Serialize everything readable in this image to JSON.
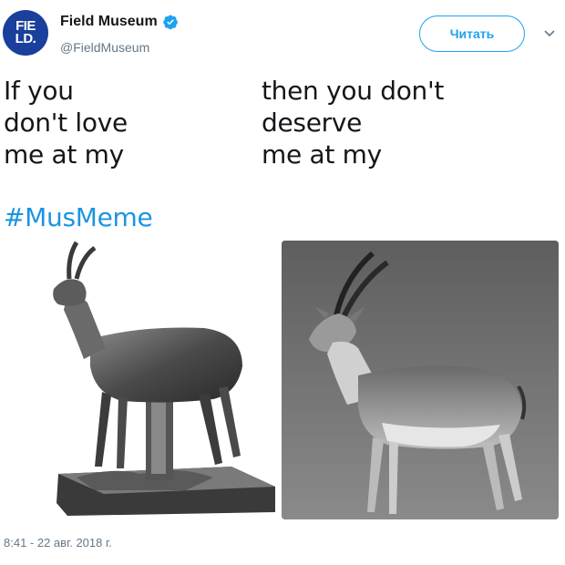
{
  "account": {
    "avatar_text_line1": "FIE",
    "avatar_text_line2": "LD.",
    "name": "Field Museum",
    "handle": "@FieldMuseum",
    "verified": true
  },
  "actions": {
    "follow_label": "Читать",
    "menu_icon": "chevron-down-icon"
  },
  "tweet": {
    "left_lines": [
      "If you",
      "don't love",
      "me at my"
    ],
    "right_lines": [
      "then you don't",
      "deserve",
      "me at my"
    ],
    "hashtag": "#MusMeme",
    "timestamp": "8:41 - 22 авг. 2018 г."
  },
  "colors": {
    "accent": "#1da1f2",
    "hashtag": "#1b95e0",
    "avatar_bg": "#1a3f9c",
    "secondary_text": "#657786"
  }
}
